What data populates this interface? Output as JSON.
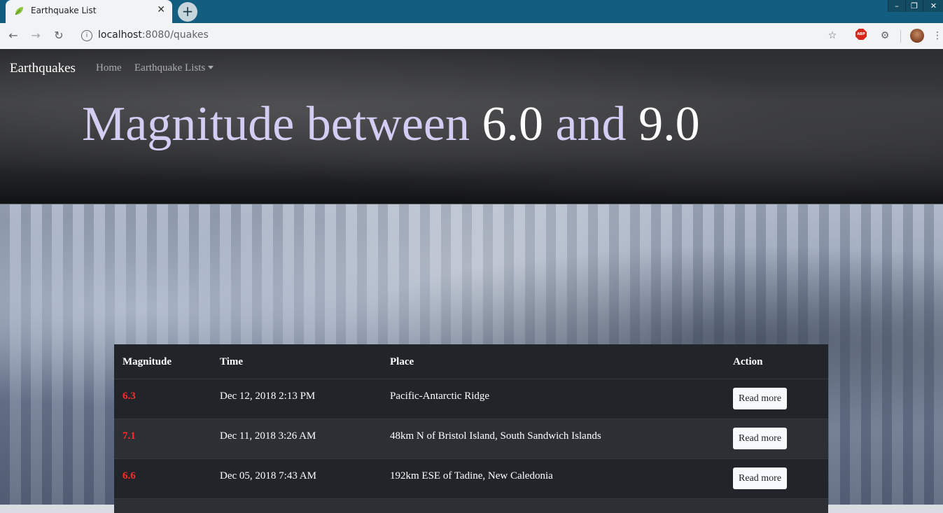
{
  "browser": {
    "tab_title": "Earthquake List",
    "tab_close": "✕",
    "new_tab": "+",
    "url_host": "localhost",
    "url_path": ":8080/quakes",
    "abp_label": "ABP",
    "window_controls": [
      "–",
      "❐",
      "✕"
    ]
  },
  "navbar": {
    "brand": "Earthquakes",
    "home": "Home",
    "lists": "Earthquake Lists"
  },
  "header": {
    "prefix": "Magnitude between ",
    "min": "6.0",
    "middle": " and ",
    "max": "9.0"
  },
  "table": {
    "headers": [
      "Magnitude",
      "Time",
      "Place",
      "Action"
    ],
    "rows": [
      {
        "magnitude": "6.3",
        "time": "Dec 12, 2018 2:13 PM",
        "place": "Pacific-Antarctic Ridge",
        "action": "Read more"
      },
      {
        "magnitude": "7.1",
        "time": "Dec 11, 2018 3:26 AM",
        "place": "48km N of Bristol Island, South Sandwich Islands",
        "action": "Read more"
      },
      {
        "magnitude": "6.6",
        "time": "Dec 05, 2018 7:43 AM",
        "place": "192km ESE of Tadine, New Caledonia",
        "action": "Read more"
      }
    ]
  },
  "colors": {
    "tabstrip": "#115e80",
    "navbar_bg": "#2c2d2f",
    "headline_text": "#d4ccf2",
    "table_bg": "#212529",
    "magnitude_text": "#ff2b2b"
  },
  "icons": [
    "leaf-favicon-icon",
    "close-icon",
    "plus-icon",
    "back-arrow-icon",
    "forward-arrow-icon",
    "reload-icon",
    "info-icon",
    "star-icon",
    "adblock-icon",
    "extension-icon",
    "profile-avatar",
    "more-menu-icon"
  ]
}
